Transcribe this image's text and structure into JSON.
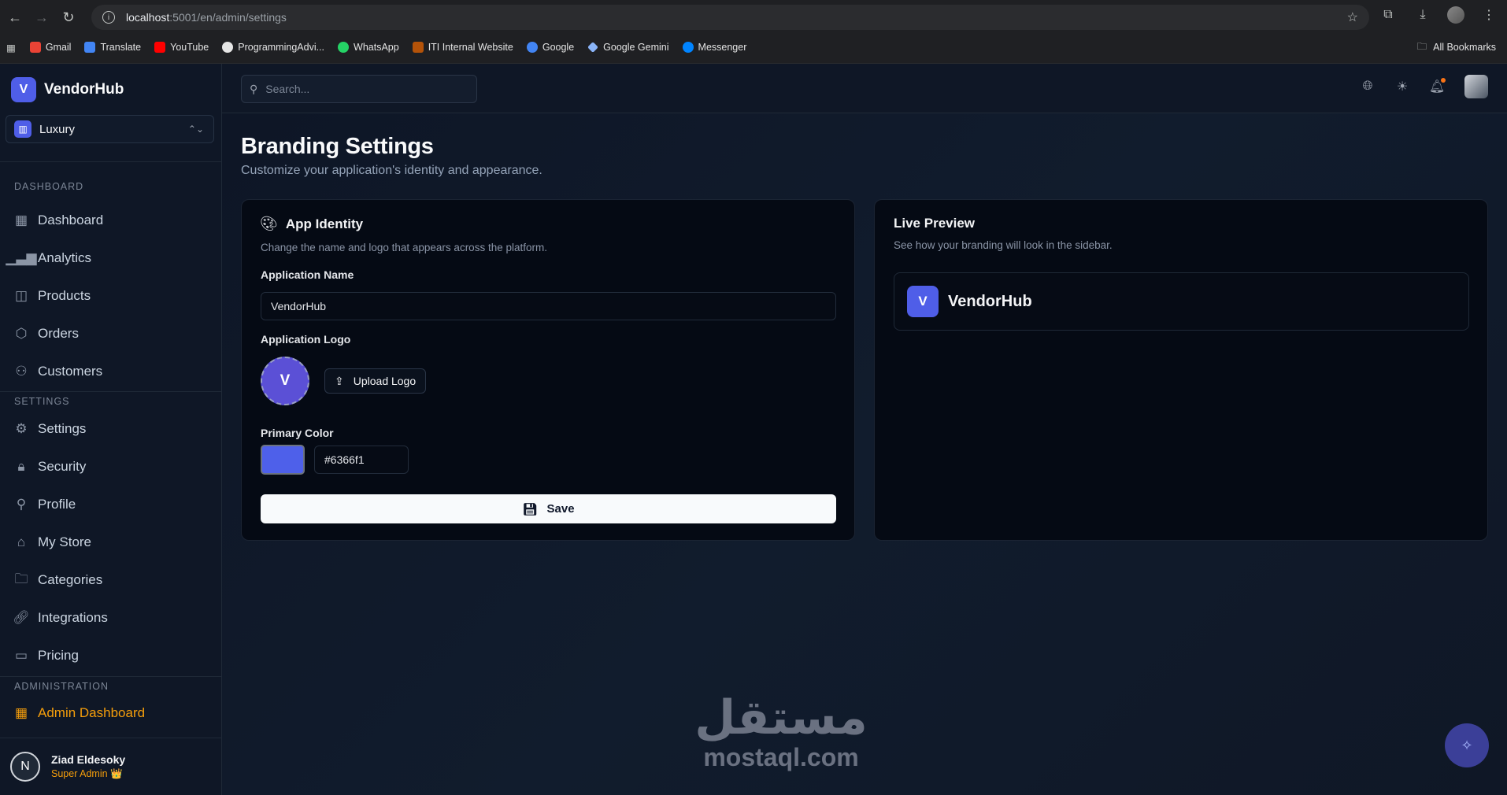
{
  "browser": {
    "url_host": "localhost",
    "url_path": ":5001/en/admin/settings",
    "bookmarks": [
      {
        "label": "Gmail",
        "color": "#ea4335"
      },
      {
        "label": "Translate",
        "color": "#4285f4"
      },
      {
        "label": "YouTube",
        "color": "#ff0000"
      },
      {
        "label": "ProgrammingAdvi...",
        "color": "#e5e5e5"
      },
      {
        "label": "WhatsApp",
        "color": "#25d366"
      },
      {
        "label": "ITI Internal Website",
        "color": "#b45309"
      },
      {
        "label": "Google",
        "color": "#4285f4"
      },
      {
        "label": "Google Gemini",
        "color": "#8ab4f8"
      },
      {
        "label": "Messenger",
        "color": "#0084ff"
      }
    ],
    "all_bookmarks": "All Bookmarks"
  },
  "sidebar": {
    "brand": {
      "logo_letter": "V",
      "name": "VendorHub"
    },
    "store": {
      "name": "Luxury"
    },
    "sections": {
      "dashboard": "DASHBOARD",
      "settings": "SETTINGS",
      "administration": "ADMINISTRATION"
    },
    "items": [
      {
        "label": "Dashboard",
        "icon": "grid-icon"
      },
      {
        "label": "Analytics",
        "icon": "bar-chart-icon"
      },
      {
        "label": "Products",
        "icon": "shopping-bag-icon"
      },
      {
        "label": "Orders",
        "icon": "package-icon"
      },
      {
        "label": "Customers",
        "icon": "users-icon"
      },
      {
        "label": "Settings",
        "icon": "gear-icon"
      },
      {
        "label": "Security",
        "icon": "lock-icon"
      },
      {
        "label": "Profile",
        "icon": "user-icon"
      },
      {
        "label": "My Store",
        "icon": "store-icon"
      },
      {
        "label": "Categories",
        "icon": "folder-icon"
      },
      {
        "label": "Integrations",
        "icon": "link-icon"
      },
      {
        "label": "Pricing",
        "icon": "credit-card-icon"
      },
      {
        "label": "Admin Dashboard",
        "icon": "grid-icon"
      }
    ],
    "user": {
      "initial": "N",
      "name": "Ziad Eldesoky",
      "role": "Super Admin 👑"
    }
  },
  "topbar": {
    "search_placeholder": "Search..."
  },
  "page": {
    "title": "Branding Settings",
    "subtitle": "Customize your application's identity and appearance."
  },
  "identity_card": {
    "title": "App Identity",
    "description": "Change the name and logo that appears across the platform.",
    "name_label": "Application Name",
    "name_value": "VendorHub",
    "logo_label": "Application Logo",
    "logo_letter": "V",
    "upload_label": "Upload Logo",
    "color_label": "Primary Color",
    "color_value": "#6366f1",
    "save_label": "Save"
  },
  "preview_card": {
    "title": "Live Preview",
    "description": "See how your branding will look in the sidebar.",
    "logo_letter": "V",
    "name": "VendorHub"
  },
  "watermark": {
    "arabic": "مستقل",
    "latin": "mostaql.com"
  }
}
